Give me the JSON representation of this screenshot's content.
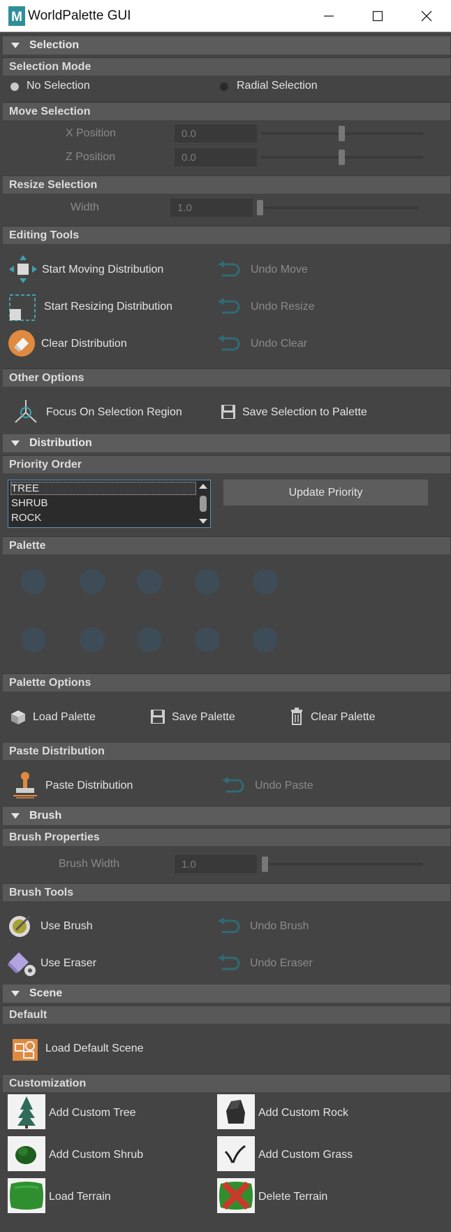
{
  "window": {
    "title": "WorldPalette GUI",
    "logo_letter": "M",
    "controls": [
      "minimize-icon",
      "maximize-icon",
      "close-icon"
    ]
  },
  "selection": {
    "header": "Selection",
    "mode": {
      "header": "Selection Mode",
      "options": [
        {
          "label": "No Selection",
          "selected": true
        },
        {
          "label": "Radial Selection",
          "selected": false
        }
      ]
    },
    "move": {
      "header": "Move Selection",
      "x_label": "X Position",
      "x_value": "0.0",
      "z_label": "Z Position",
      "z_value": "0.0"
    },
    "resize": {
      "header": "Resize Selection",
      "width_label": "Width",
      "width_value": "1.0"
    },
    "editing": {
      "header": "Editing Tools",
      "start_move": "Start Moving Distribution",
      "undo_move": "Undo Move",
      "start_resize": "Start Resizing Distribution",
      "undo_resize": "Undo Resize",
      "clear": "Clear Distribution",
      "undo_clear": "Undo Clear"
    },
    "other": {
      "header": "Other Options",
      "focus": "Focus On Selection Region",
      "save_to_palette": "Save Selection to Palette"
    }
  },
  "distribution": {
    "header": "Distribution",
    "priority": {
      "header": "Priority Order",
      "items": [
        "TREE",
        "SHRUB",
        "ROCK"
      ],
      "selected_index": 0,
      "update_button": "Update Priority"
    },
    "palette": {
      "header": "Palette",
      "slot_count": 10
    },
    "palette_options": {
      "header": "Palette Options",
      "load": "Load Palette",
      "save": "Save Palette",
      "clear": "Clear Palette"
    },
    "paste": {
      "header": "Paste Distribution",
      "paste": "Paste Distribution",
      "undo_paste": "Undo Paste"
    }
  },
  "brush": {
    "header": "Brush",
    "properties": {
      "header": "Brush Properties",
      "width_label": "Brush Width",
      "width_value": "1.0"
    },
    "tools": {
      "header": "Brush Tools",
      "use_brush": "Use Brush",
      "undo_brush": "Undo Brush",
      "use_eraser": "Use Eraser",
      "undo_eraser": "Undo Eraser"
    }
  },
  "scene": {
    "header": "Scene",
    "default": {
      "header": "Default",
      "load_default": "Load Default Scene"
    },
    "customization": {
      "header": "Customization",
      "add_tree": "Add Custom Tree",
      "add_rock": "Add Custom Rock",
      "add_shrub": "Add Custom Shrub",
      "add_grass": "Add Custom Grass",
      "load_terrain": "Load Terrain",
      "delete_terrain": "Delete Terrain"
    }
  },
  "colors": {
    "background": "#444444",
    "section_header": "#5c5c5c",
    "accent_teal": "#3d8a98",
    "accent_orange": "#e08a40",
    "disabled_text": "#8a8a8a",
    "palette_slot": "#3e4c57"
  }
}
